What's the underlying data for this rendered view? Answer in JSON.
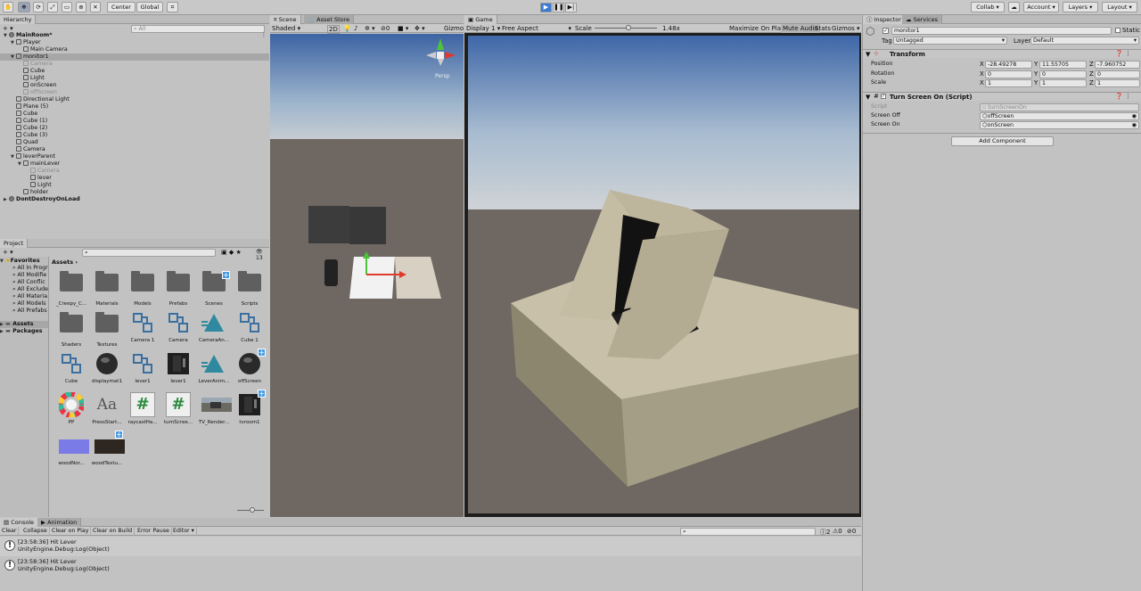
{
  "toolbar": {
    "pivot": "Center",
    "space": "Global",
    "collab": "Collab",
    "account": "Account",
    "layers": "Layers",
    "layout": "Layout"
  },
  "hierarchy": {
    "tab": "Hierarchy",
    "search_placeholder": "All",
    "items": [
      {
        "label": "MainRoom*",
        "depth": 0,
        "type": "scene",
        "expanded": true
      },
      {
        "label": "Player",
        "depth": 1,
        "type": "go",
        "expanded": true
      },
      {
        "label": "Main Camera",
        "depth": 2,
        "type": "go"
      },
      {
        "label": "monitor1",
        "depth": 1,
        "type": "go",
        "expanded": true,
        "selected": true
      },
      {
        "label": "Camera",
        "depth": 2,
        "type": "go",
        "dim": true
      },
      {
        "label": "Cube",
        "depth": 2,
        "type": "go"
      },
      {
        "label": "Light",
        "depth": 2,
        "type": "go"
      },
      {
        "label": "onScreen",
        "depth": 2,
        "type": "go"
      },
      {
        "label": "offScreen",
        "depth": 2,
        "type": "go",
        "dim": true
      },
      {
        "label": "Directional Light",
        "depth": 1,
        "type": "go"
      },
      {
        "label": "Plane (5)",
        "depth": 1,
        "type": "go"
      },
      {
        "label": "Cube",
        "depth": 1,
        "type": "go"
      },
      {
        "label": "Cube (1)",
        "depth": 1,
        "type": "go"
      },
      {
        "label": "Cube (2)",
        "depth": 1,
        "type": "go"
      },
      {
        "label": "Cube (3)",
        "depth": 1,
        "type": "go"
      },
      {
        "label": "Quad",
        "depth": 1,
        "type": "go"
      },
      {
        "label": "Camera",
        "depth": 1,
        "type": "go"
      },
      {
        "label": "leverParent",
        "depth": 1,
        "type": "go",
        "expanded": true
      },
      {
        "label": "mainLever",
        "depth": 2,
        "type": "go",
        "expanded": true
      },
      {
        "label": "Camera",
        "depth": 3,
        "type": "go",
        "dim": true
      },
      {
        "label": "lever",
        "depth": 3,
        "type": "go"
      },
      {
        "label": "Light",
        "depth": 3,
        "type": "go"
      },
      {
        "label": "holder",
        "depth": 2,
        "type": "go"
      },
      {
        "label": "DontDestroyOnLoad",
        "depth": 0,
        "type": "scene",
        "expanded": false
      }
    ]
  },
  "project": {
    "tab": "Project",
    "count": "13",
    "favorites_label": "Favorites",
    "favorites": [
      "All In Progr",
      "All Modifie",
      "All Conflic",
      "All Exclude",
      "All Materia",
      "All Models",
      "All Prefabs"
    ],
    "assets_label": "Assets",
    "packages_label": "Packages",
    "breadcrumb": "Assets",
    "assets": [
      {
        "label": "_Creepy_C...",
        "kind": "folder"
      },
      {
        "label": "Materials",
        "kind": "folder"
      },
      {
        "label": "Models",
        "kind": "folder"
      },
      {
        "label": "Prefabs",
        "kind": "folder"
      },
      {
        "label": "Scenes",
        "kind": "folder-badge"
      },
      {
        "label": "Scripts",
        "kind": "folder"
      },
      {
        "label": "Shaders",
        "kind": "folder"
      },
      {
        "label": "Textures",
        "kind": "folder"
      },
      {
        "label": "Camera 1",
        "kind": "prefab"
      },
      {
        "label": "Camera",
        "kind": "prefab"
      },
      {
        "label": "CameraAn...",
        "kind": "anim"
      },
      {
        "label": "Cube 1",
        "kind": "prefab"
      },
      {
        "label": "Cube",
        "kind": "prefab"
      },
      {
        "label": "displaymat1",
        "kind": "sphere"
      },
      {
        "label": "lever1",
        "kind": "prefab"
      },
      {
        "label": "lever1",
        "kind": "model"
      },
      {
        "label": "LeverAnim...",
        "kind": "anim"
      },
      {
        "label": "offScreen",
        "kind": "sphere-badge"
      },
      {
        "label": "PP",
        "kind": "wheel"
      },
      {
        "label": "PressStart...",
        "kind": "font"
      },
      {
        "label": "raycastHa...",
        "kind": "script"
      },
      {
        "label": "turnScree...",
        "kind": "script-badge"
      },
      {
        "label": "TV_Render...",
        "kind": "render"
      },
      {
        "label": "tvroom1",
        "kind": "model-badge"
      },
      {
        "label": "woodNor...",
        "kind": "normal"
      },
      {
        "label": "woodTextu...",
        "kind": "wood-badge"
      }
    ],
    "asset_glyphs": {
      "font": "Aa",
      "script": "#"
    }
  },
  "scene": {
    "tabs": [
      "Scene",
      "Asset Store"
    ],
    "shading": "Shaded",
    "mode2d": "2D",
    "hidden_count": "0",
    "gizmos": "Gizmos",
    "persp": "Persp"
  },
  "game": {
    "tab": "Game",
    "display": "Display 1",
    "aspect": "Free Aspect",
    "scale_label": "Scale",
    "scale_value": "1.48x",
    "scale_fraction": 0.1,
    "maximize": "Maximize On Play",
    "mute": "Mute Audio",
    "stats": "Stats",
    "gizmos": "Gizmos"
  },
  "inspector": {
    "tabs": [
      "Inspector",
      "Services"
    ],
    "object_name": "monitor1",
    "static_label": "Static",
    "tag_label": "Tag",
    "tag_value": "Untagged",
    "layer_label": "Layer",
    "layer_value": "Default",
    "transform": {
      "title": "Transform",
      "position_label": "Position",
      "rotation_label": "Rotation",
      "scale_label": "Scale",
      "position": {
        "x": "-28.49278",
        "y": "11.55705",
        "z": "-7.960752"
      },
      "rotation": {
        "x": "0",
        "y": "0",
        "z": "0"
      },
      "scale": {
        "x": "1",
        "y": "1",
        "z": "1"
      }
    },
    "script_comp": {
      "title": "Turn Screen On (Script)",
      "script_label": "Script",
      "script_value": "turnScreenOn",
      "off_label": "Screen Off",
      "off_value": "offScreen",
      "on_label": "Screen On",
      "on_value": "onScreen"
    },
    "add_component": "Add Component"
  },
  "console": {
    "tabs": [
      "Console",
      "Animation"
    ],
    "buttons": [
      "Clear",
      "Collapse",
      "Clear on Play",
      "Clear on Build",
      "Error Pause",
      "Editor"
    ],
    "counts": {
      "log": "2",
      "warn": "0",
      "error": "0"
    },
    "entries": [
      {
        "line1": "[23:58:36] Hit Lever",
        "line2": "UnityEngine.Debug:Log(Object)"
      },
      {
        "line1": "[23:58:36] Hit Lever",
        "line2": "UnityEngine.Debug:Log(Object)"
      }
    ]
  },
  "colors": {
    "accent": "#3a7bd5",
    "sky_top": "#3b66a8",
    "ground": "#6d6660",
    "model": "#c9c1a9"
  }
}
